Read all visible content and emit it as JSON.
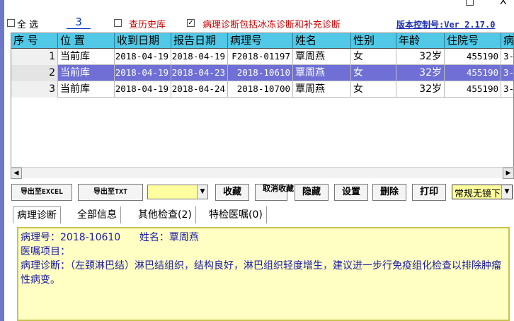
{
  "window": {
    "restore_glyph": "□",
    "close_glyph": "X"
  },
  "topbar": {
    "select_all_label": "全 选",
    "count": "3",
    "history_check_label": "查历史库",
    "history_checked": false,
    "include_frozen_label": "病理诊断包括冰冻诊断和补充诊断",
    "include_frozen_checked": true,
    "version": "版本控制号:Ver 2.17.0"
  },
  "grid": {
    "columns": [
      "序 号",
      "位 置",
      "收到日期",
      "报告日期",
      "病理号",
      "姓名",
      "性别",
      "年龄",
      "住院号",
      "病"
    ],
    "rows": [
      {
        "no": "1",
        "location": "当前库",
        "received": "2018-04-19",
        "reported": "2018-04-19",
        "pathology_no": "F2018-01197",
        "name": "覃周燕",
        "sex": "女",
        "age": "32岁",
        "admission_no": "455190",
        "extra": "3-",
        "selected": false
      },
      {
        "no": "2",
        "location": "当前库",
        "received": "2018-04-19",
        "reported": "2018-04-23",
        "pathology_no": "2018-10610",
        "name": "覃周燕",
        "sex": "女",
        "age": "32岁",
        "admission_no": "455190",
        "extra": "3-",
        "selected": true
      },
      {
        "no": "3",
        "location": "当前库",
        "received": "2018-04-19",
        "reported": "2018-04-24",
        "pathology_no": "2018-10700",
        "name": "覃周燕",
        "sex": "女",
        "age": "32岁",
        "admission_no": "455190",
        "extra": "3-",
        "selected": false
      }
    ]
  },
  "toolbar": {
    "export_excel": "导出至EXCEL",
    "export_txt": "导出至TXT",
    "filter_value": "",
    "collect": "收藏",
    "cancel_collect": "取消收藏",
    "hide": "隐藏",
    "settings": "设置",
    "delete": "删除",
    "print": "打印",
    "mirror_select": "常规无镜下"
  },
  "tabs": [
    "病理诊断",
    "全部信息",
    "其他检查(2)",
    "特检医嘱(0)"
  ],
  "detail": {
    "line1": "病理号：2018-10610      姓名：覃周燕",
    "line2": "医嘱项目：",
    "line3": "病理诊断：（左颈淋巴结）淋巴结组织，结构良好，淋巴组织轻度增生，建议进一步行免疫组化检查以排除肿瘤性病变。"
  },
  "colors": {
    "header_bg": "#50c8e6",
    "selected_row": "#6f6fd6",
    "panel_bg": "#ffffc4",
    "accent_red": "#cc0000",
    "accent_blue": "#1a2db3"
  }
}
